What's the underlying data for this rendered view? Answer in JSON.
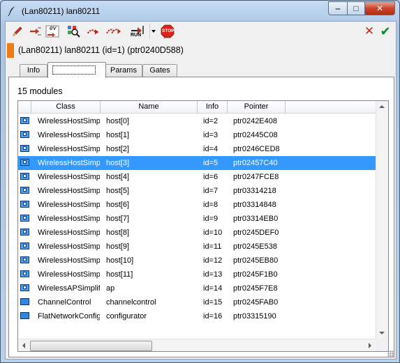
{
  "window": {
    "title": "(Lan80211) lan80211",
    "minimize_glyph": "‒",
    "maximize_glyph": "□",
    "close_glyph": "✕"
  },
  "toolbar": {
    "icons": [
      "edit-pencil-icon",
      "step-arrow-icon",
      "ev-step-icon",
      "inspect-magnifier-icon",
      "run-arrow-icon",
      "fast-run-arrow-icon",
      "run-until-icon",
      "run-dropdown-icon",
      "stop-icon",
      "cancel-icon",
      "ok-check-icon"
    ],
    "ev_label": "ev",
    "run_label": "RUN",
    "stop_label": "STOP",
    "cancel_glyph": "✕",
    "ok_glyph": "✔"
  },
  "object": {
    "label": "(Lan80211) lan80211  (id=1)  (ptr0240D588)",
    "marker_color": "#f07a14"
  },
  "tabs": [
    {
      "label": "Info"
    },
    {
      "label": ""
    },
    {
      "label": "Params"
    },
    {
      "label": "Gates"
    }
  ],
  "modules": {
    "count_label": "15 modules",
    "columns": [
      "Class",
      "Name",
      "Info",
      "Pointer"
    ],
    "rows": [
      {
        "class": "WirelessHostSimpl",
        "name": "host[0]",
        "info": "id=2",
        "pointer": "ptr0242E408",
        "icon": "host"
      },
      {
        "class": "WirelessHostSimpl",
        "name": "host[1]",
        "info": "id=3",
        "pointer": "ptr02445C08",
        "icon": "host"
      },
      {
        "class": "WirelessHostSimpl",
        "name": "host[2]",
        "info": "id=4",
        "pointer": "ptr0246CED8",
        "icon": "host"
      },
      {
        "class": "WirelessHostSimpl",
        "name": "host[3]",
        "info": "id=5",
        "pointer": "ptr02457C40",
        "icon": "host",
        "selected": true
      },
      {
        "class": "WirelessHostSimpl",
        "name": "host[4]",
        "info": "id=6",
        "pointer": "ptr0247FCE8",
        "icon": "host"
      },
      {
        "class": "WirelessHostSimpl",
        "name": "host[5]",
        "info": "id=7",
        "pointer": "ptr03314218",
        "icon": "host"
      },
      {
        "class": "WirelessHostSimpl",
        "name": "host[6]",
        "info": "id=8",
        "pointer": "ptr03314848",
        "icon": "host"
      },
      {
        "class": "WirelessHostSimpl",
        "name": "host[7]",
        "info": "id=9",
        "pointer": "ptr03314EB0",
        "icon": "host"
      },
      {
        "class": "WirelessHostSimpl",
        "name": "host[8]",
        "info": "id=10",
        "pointer": "ptr0245DEF0",
        "icon": "host"
      },
      {
        "class": "WirelessHostSimpl",
        "name": "host[9]",
        "info": "id=11",
        "pointer": "ptr0245E538",
        "icon": "host"
      },
      {
        "class": "WirelessHostSimpl",
        "name": "host[10]",
        "info": "id=12",
        "pointer": "ptr0245EB80",
        "icon": "host"
      },
      {
        "class": "WirelessHostSimpl",
        "name": "host[11]",
        "info": "id=13",
        "pointer": "ptr0245F1B0",
        "icon": "host"
      },
      {
        "class": "WirelessAPSimplifi",
        "name": "ap",
        "info": "id=14",
        "pointer": "ptr0245F7E8",
        "icon": "host"
      },
      {
        "class": "ChannelControl",
        "name": "channelcontrol",
        "info": "id=15",
        "pointer": "ptr0245FAB0",
        "icon": "plain"
      },
      {
        "class": "FlatNetworkConfig",
        "name": "configurator",
        "info": "id=16",
        "pointer": "ptr03315190",
        "icon": "plain"
      }
    ]
  },
  "colors": {
    "selection": "#3399ff",
    "window_frame": "#bcd3ea",
    "module_icon": "#4aa0ea"
  }
}
